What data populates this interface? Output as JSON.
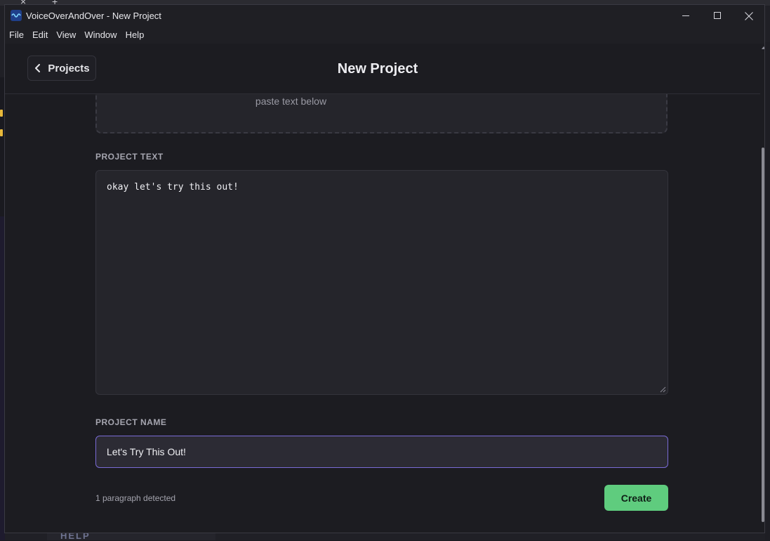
{
  "window": {
    "title": "VoiceOverAndOver - New Project",
    "icon": "app-logo-icon"
  },
  "menu": [
    "File",
    "Edit",
    "View",
    "Window",
    "Help"
  ],
  "header": {
    "back_label": "Projects",
    "title": "New Project"
  },
  "dropzone": {
    "hint": "paste text below"
  },
  "project_text": {
    "label": "PROJECT TEXT",
    "value": "okay let's try this out!"
  },
  "project_name": {
    "label": "PROJECT NAME",
    "value": "Let's Try This Out!"
  },
  "footer": {
    "status": "1 paragraph detected",
    "create_label": "Create"
  },
  "background": {
    "help_label": "HELP"
  },
  "colors": {
    "accent_border": "#7a6bd6",
    "create_button": "#5fcc7e",
    "background": "#1c1c21"
  }
}
